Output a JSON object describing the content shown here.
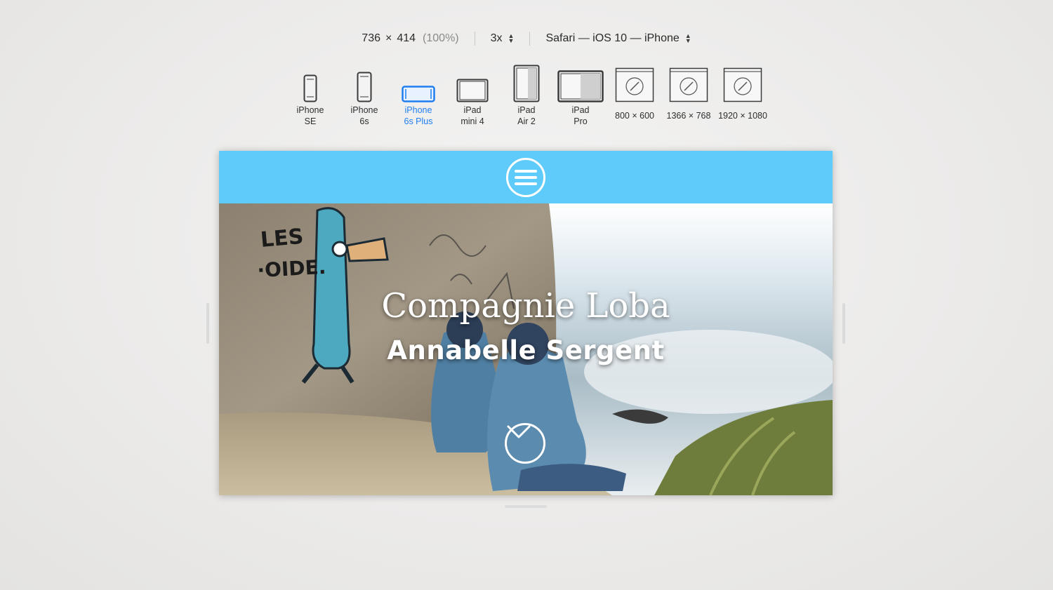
{
  "toolbar": {
    "width": "736",
    "times": "×",
    "height": "414",
    "percent": "(100%)",
    "scale": "3x",
    "user_agent": "Safari — iOS 10 — iPhone"
  },
  "devices": [
    {
      "label": "iPhone\nSE",
      "icon": "iphone-portrait-icon"
    },
    {
      "label": "iPhone\n6s",
      "icon": "iphone-portrait-icon"
    },
    {
      "label": "iPhone\n6s Plus",
      "icon": "iphone-landscape-icon",
      "active": true
    },
    {
      "label": "iPad\nmini 4",
      "icon": "ipad-landscape-icon"
    },
    {
      "label": "iPad\nAir 2",
      "icon": "ipad-split-icon"
    },
    {
      "label": "iPad\nPro",
      "icon": "ipad-pro-split-icon"
    },
    {
      "label": "800 × 600",
      "icon": "safari-window-icon"
    },
    {
      "label": "1366 × 768",
      "icon": "safari-window-icon"
    },
    {
      "label": "1920 × 1080",
      "icon": "safari-window-icon"
    }
  ],
  "site": {
    "title": "Compagnie Loba",
    "subtitle": "Annabelle Sergent",
    "graffiti_text": "LES\n·OIDE.",
    "header_color": "#5fcbfa"
  },
  "colors": {
    "accent": "#1e7ef0"
  }
}
